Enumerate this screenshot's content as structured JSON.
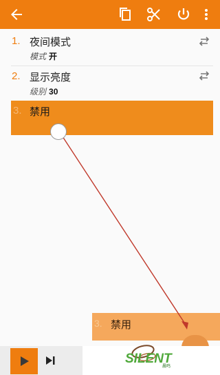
{
  "toolbar": {
    "icons": [
      "back-arrow-icon",
      "copy-icon",
      "cut-icon",
      "power-icon",
      "more-vert-icon"
    ]
  },
  "items": [
    {
      "number": "1.",
      "title": "夜间模式",
      "sub_key": "模式",
      "sub_value": "开"
    },
    {
      "number": "2.",
      "title": "显示亮度",
      "sub_key": "级别",
      "sub_value": "30"
    }
  ],
  "drag_item": {
    "number": "3.",
    "title": "禁用"
  },
  "drop_item": {
    "number": "3.",
    "title": "禁用"
  },
  "watermark": {
    "text": "SILENT",
    "small": "晨鸣"
  },
  "colors": {
    "accent": "#ef7d0f",
    "drag_highlight": "#ef8c1c",
    "drop_highlight": "#f5a85c",
    "arrow": "#c0392b"
  }
}
